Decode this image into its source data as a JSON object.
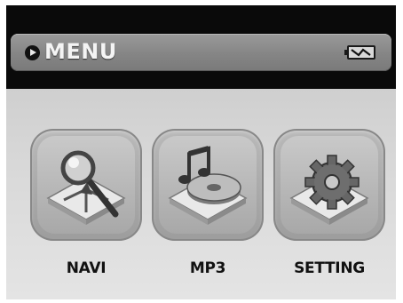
{
  "header": {
    "title": "MENU",
    "title_icon": "play-circle-icon",
    "status_icon": "battery-charging-icon"
  },
  "menu": {
    "items": [
      {
        "label": "NAVI",
        "icon": "navigation-magnifier-icon"
      },
      {
        "label": "MP3",
        "icon": "music-disc-icon"
      },
      {
        "label": "SETTING",
        "icon": "gear-icon"
      }
    ]
  }
}
